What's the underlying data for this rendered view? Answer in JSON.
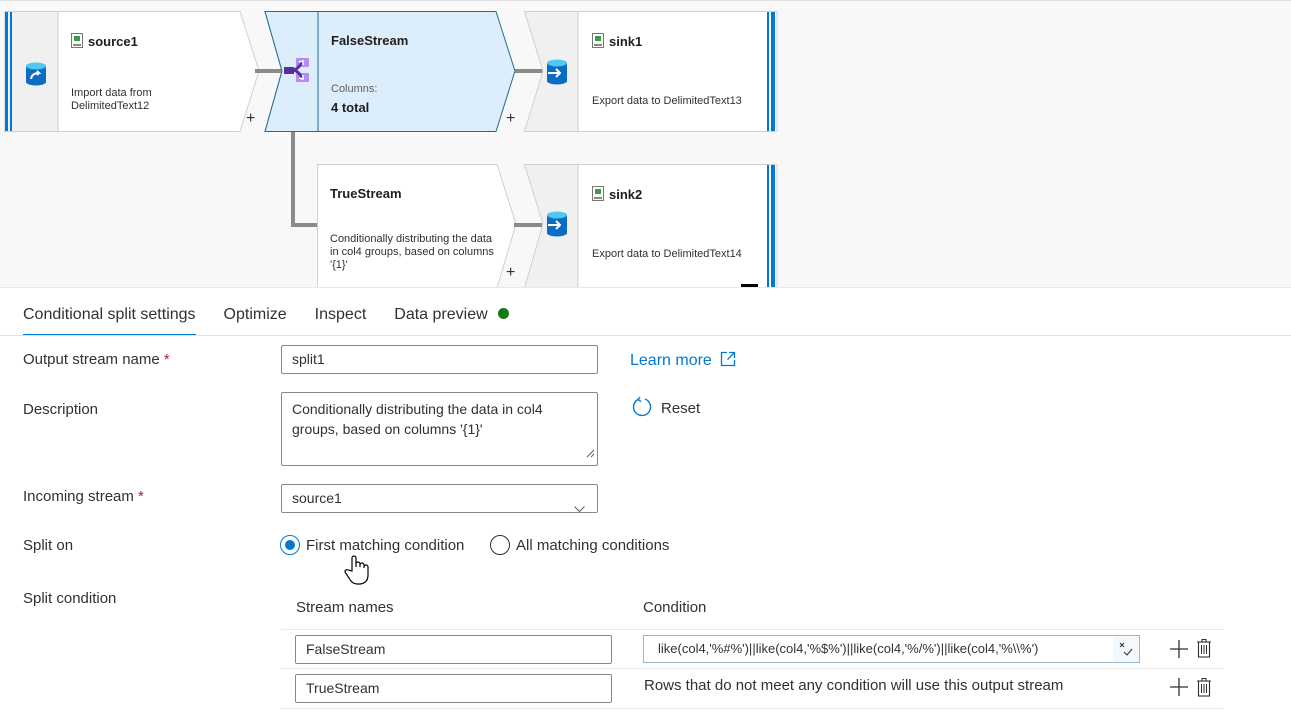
{
  "canvas": {
    "nodes": {
      "source1": {
        "title": "source1",
        "subtitle": "Import data from DelimitedText12",
        "icon": "source-database-icon"
      },
      "split1": {
        "title": "FalseStream",
        "columns_label": "Columns:",
        "columns_value": "4 total",
        "icon": "conditional-split-icon"
      },
      "truestream": {
        "title": "TrueStream",
        "subtitle": "Conditionally distributing the data in col4 groups, based on columns '{1}'"
      },
      "sink1": {
        "title": "sink1",
        "subtitle": "Export data to DelimitedText13",
        "icon": "sink-database-icon"
      },
      "sink2": {
        "title": "sink2",
        "subtitle": "Export data to DelimitedText14",
        "icon": "sink-database-icon"
      }
    },
    "add_label": "+"
  },
  "panel": {
    "tabs": [
      {
        "label": "Conditional split settings",
        "active": true
      },
      {
        "label": "Optimize",
        "active": false
      },
      {
        "label": "Inspect",
        "active": false
      },
      {
        "label": "Data preview",
        "active": false,
        "status_color": "#107c10"
      }
    ],
    "form": {
      "output_stream_name": {
        "label": "Output stream name",
        "required": "*",
        "value": "split1"
      },
      "description": {
        "label": "Description",
        "value": "Conditionally distributing the data in col4 groups, based on columns '{1}'"
      },
      "incoming_stream": {
        "label": "Incoming stream",
        "required": "*",
        "value": "source1"
      },
      "split_on": {
        "label": "Split on",
        "options": [
          {
            "label": "First matching condition",
            "checked": true
          },
          {
            "label": "All matching conditions",
            "checked": false
          }
        ]
      },
      "split_condition": {
        "label": "Split condition",
        "columns": [
          "Stream names",
          "Condition"
        ],
        "rows": [
          {
            "stream": "FalseStream",
            "condition": "like(col4,'%#%')||like(col4,'%$%')||like(col4,'%/%')||like(col4,'%\\\\%')"
          },
          {
            "stream": "TrueStream",
            "condition": "Rows that do not meet any condition will use this output stream"
          }
        ]
      }
    },
    "learn_more": "Learn more",
    "reset": "Reset"
  },
  "colors": {
    "accent": "#0078d4",
    "selected_node_bg": "#dcedfc",
    "selected_node_border": "#1e6f8e",
    "status_ok": "#107c10",
    "required": "#a4262c"
  }
}
